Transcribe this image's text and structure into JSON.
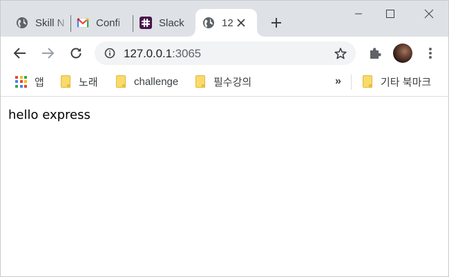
{
  "tabs": [
    {
      "title": "Skill N",
      "icon": "globe-icon",
      "active": false
    },
    {
      "title": "Confi",
      "icon": "gmail-icon",
      "active": false
    },
    {
      "title": "Slack",
      "icon": "slack-icon",
      "active": false
    },
    {
      "title": "12",
      "icon": "globe-icon",
      "active": true
    }
  ],
  "toolbar": {
    "url_host": "127.0.0.1",
    "url_port": ":3065"
  },
  "bookmarks": {
    "apps_label": "앱",
    "items": [
      {
        "label": "노래"
      },
      {
        "label": "challenge"
      },
      {
        "label": "필수강의"
      }
    ],
    "overflow": "»",
    "other_label": "기타 북마크"
  },
  "page": {
    "body_text": "hello express"
  },
  "colors": {
    "tabstrip_bg": "#dee1e6",
    "omnibox_bg": "#f1f3f4",
    "folder": "#f9da6c"
  }
}
